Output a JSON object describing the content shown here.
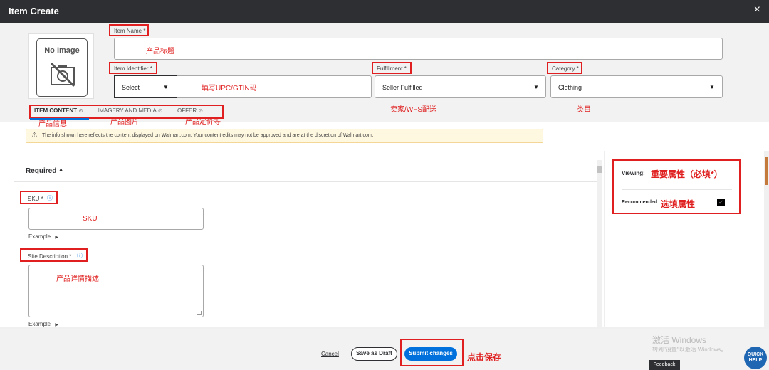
{
  "window": {
    "title": "Item Create",
    "close_glyph": "×"
  },
  "image": {
    "placeholder": "No Image",
    "icon": "no-image-icon"
  },
  "fields": {
    "item_name": {
      "label": "Item Name *",
      "value": "",
      "annotation": "产品标题"
    },
    "item_identifier": {
      "label": "Item Identifier *",
      "select_value": "Select",
      "annotation": "填写UPC/GTIN码"
    },
    "fulfillment": {
      "label": "Fulfillment *",
      "value": "Seller Fulfilled",
      "annotation": "卖家/WFS配送"
    },
    "category": {
      "label": "Category *",
      "value": "Clothing",
      "annotation": "类目"
    }
  },
  "tabs": [
    {
      "label": "ITEM CONTENT",
      "annotation": "产品信息",
      "active": true
    },
    {
      "label": "IMAGERY AND MEDIA",
      "annotation": "产品图片",
      "active": false
    },
    {
      "label": "OFFER",
      "annotation": "产品定价等",
      "active": false
    }
  ],
  "banner": {
    "text": "The info shown here reflects the content displayed on Walmart.com. Your content edits may not be approved and are at the discretion of Walmart.com."
  },
  "section": {
    "title": "Required",
    "toggle_glyph": "▲"
  },
  "sku": {
    "label": "SKU *",
    "annotation": "SKU",
    "example": "Example"
  },
  "site_description": {
    "label": "Site Description *",
    "annotation": "产品详情描述",
    "example": "Example"
  },
  "viewing": {
    "label": "Viewing:",
    "annotation": "重要属性（必填*）",
    "recommended": "Recommended",
    "recommended_annotation": "选填属性",
    "checked": true
  },
  "footer": {
    "cancel": "Cancel",
    "save_draft": "Save as Draft",
    "submit": "Submit changes",
    "submit_annotation": "点击保存"
  },
  "watermark": {
    "line1": "激活 Windows",
    "line2": "转到\"设置\"以激活 Windows。"
  },
  "feedback": "Feedback",
  "quick_help": {
    "line1": "QUICK",
    "line2": "HELP"
  },
  "colors": {
    "annotation_red": "#e02020",
    "primary_blue": "#0071dc",
    "header_dark": "#2e2f32"
  }
}
